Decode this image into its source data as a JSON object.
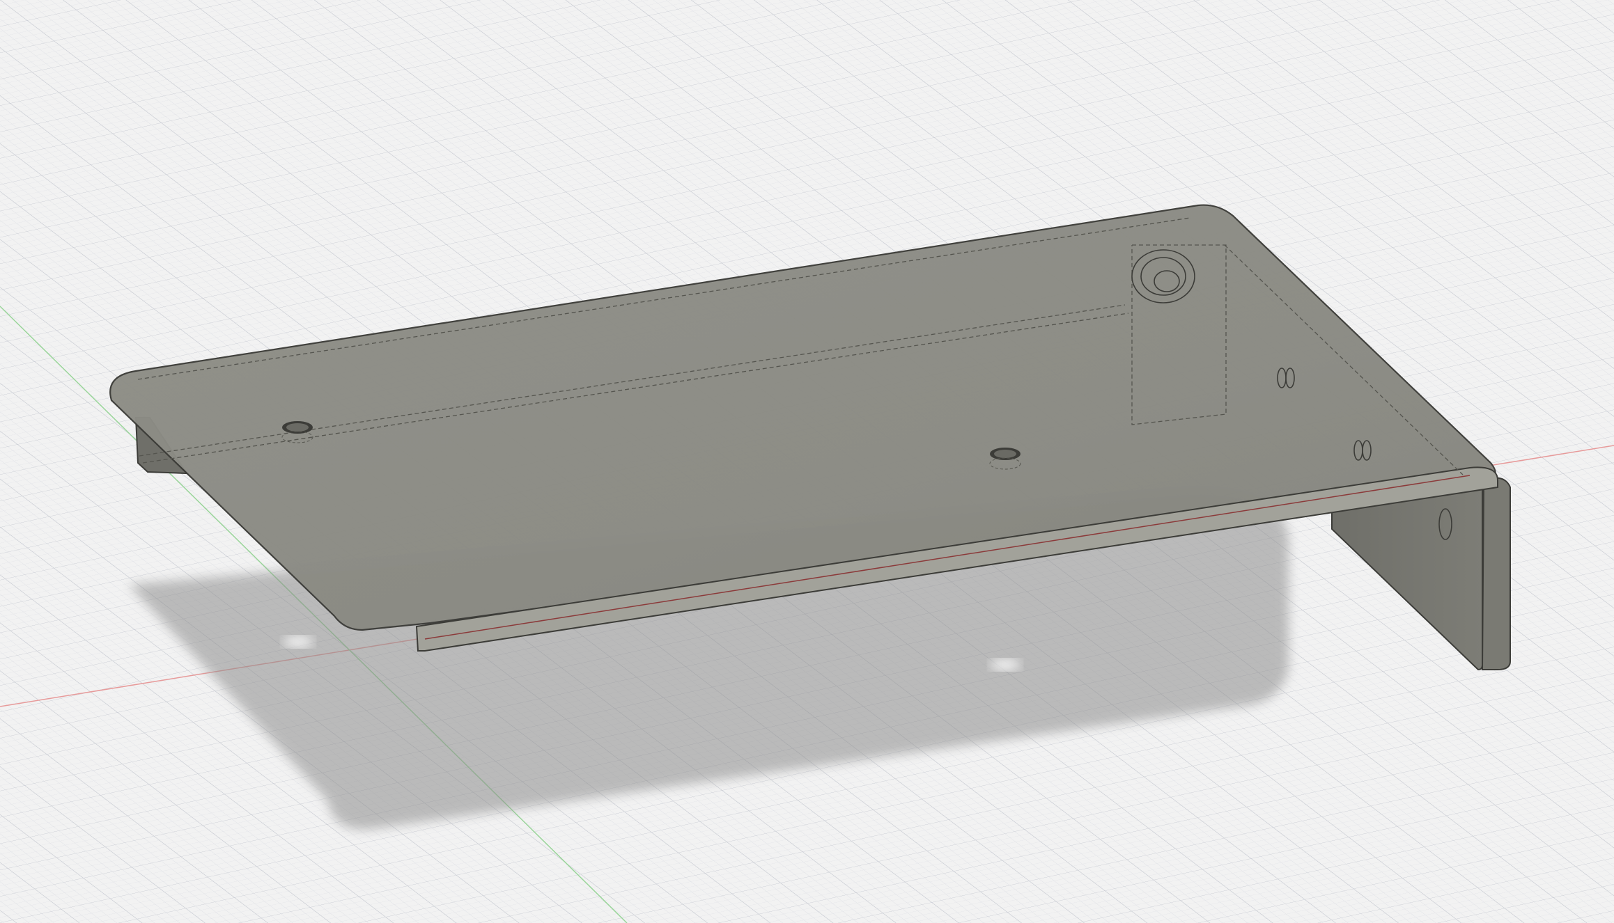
{
  "viewport": {
    "background": "#f2f2f2",
    "grid_minor_color": "#e0e2e6",
    "grid_major_color": "#cfd2d8",
    "axis_x_color": "#e38b8b",
    "axis_y_color": "#8fd18f"
  },
  "model": {
    "body_color": "#8a8a82",
    "body_color_light": "#9a9a92",
    "body_color_dark": "#6f6f69",
    "edge_color": "#3c3c38",
    "hidden_edge_color": "#55554f",
    "shadow_color": "#7a7a7a"
  }
}
